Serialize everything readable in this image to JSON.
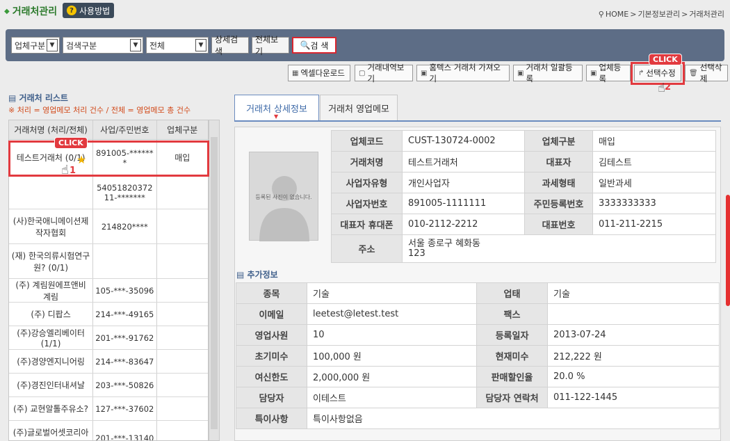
{
  "header": {
    "title": "거래처관리",
    "howto_label": "사용방법",
    "breadcrumb": [
      "HOME",
      "기본정보관리",
      "거래처관리"
    ]
  },
  "search": {
    "select1": "업체구분",
    "select2": "검색구분",
    "select3": "전체",
    "detail_search": "상세검색",
    "view_all": "전체보기",
    "search_button": "검 색"
  },
  "toolbar": {
    "excel": "엑셀다운로드",
    "history": "거래내역보기",
    "hometax": "홈텍스 거래처 가져오기",
    "bulk": "거래처 일괄등록",
    "register": "업체등록",
    "edit": "선택수정",
    "delete": "선택삭제"
  },
  "annotations": {
    "click": "CLICK",
    "step1": "1",
    "step2": "2"
  },
  "list": {
    "title": "거래처 리스트",
    "note": "※ 처리 = 영업메모 처리 건수 / 전체 = 영업메모 총 건수",
    "headers": [
      "거래처명 (처리/전체)",
      "사업/주민번호",
      "업체구분"
    ],
    "rows": [
      {
        "name": "테스트거래처 (0/1)",
        "id": "891005-*******",
        "type": "매입"
      },
      {
        "name": "",
        "id": "5405182037211-*******",
        "type": ""
      },
      {
        "name": "(사)한국애니메이션제작자협회",
        "id": "214820****",
        "type": ""
      },
      {
        "name": "(재) 한국의류시험연구원? (0/1)",
        "id": "",
        "type": ""
      },
      {
        "name": "(주) 계림원에프앤비 계림",
        "id": "105-***-35096",
        "type": ""
      },
      {
        "name": "(주) 디팝스",
        "id": "214-***-49165",
        "type": ""
      },
      {
        "name": "(주)강승엘리베이터 (1/1)",
        "id": "201-***-91762",
        "type": ""
      },
      {
        "name": "(주)경양엔지니어링",
        "id": "214-***-83647",
        "type": ""
      },
      {
        "name": "(주)경진인터내셔날",
        "id": "203-***-50826",
        "type": ""
      },
      {
        "name": "(주) 교현알톨주유소?",
        "id": "127-***-37602",
        "type": ""
      },
      {
        "name": "(주)글로벌어셋코리아보험",
        "id": "201-***-13140",
        "type": ""
      }
    ]
  },
  "tabs": {
    "detail": "거래처 상세정보",
    "memo": "거래처 영업메모"
  },
  "detail": {
    "photo_placeholder": "등록된 사진이 없습니다.",
    "code_label": "업체코드",
    "code": "CUST-130724-0002",
    "type_label": "업체구분",
    "type": "매입",
    "name_label": "거래처명",
    "name": "테스트거래처",
    "ceo_label": "대표자",
    "ceo": "김테스트",
    "biztype_label": "사업자유형",
    "biztype": "개인사업자",
    "tax_label": "과세형태",
    "tax": "일반과세",
    "bizno_label": "사업자번호",
    "bizno": "891005-1111111",
    "resno_label": "주민등록번호",
    "resno": "3333333333",
    "mobile_label": "대표자 휴대폰",
    "mobile": "010-2112-2212",
    "phone_label": "대표번호",
    "phone": "011-211-2215",
    "addr_label": "주소",
    "addr1": "서울 종로구 혜화동",
    "addr2": "123"
  },
  "extra": {
    "title": "추가정보",
    "item_label": "종목",
    "item": "기술",
    "biz_label": "업태",
    "biz": "기술",
    "email_label": "이메일",
    "email": "leetest@letest.test",
    "fax_label": "팩스",
    "fax": "",
    "sales_label": "영업사원",
    "sales": "10",
    "regdate_label": "등록일자",
    "regdate": "2013-07-24",
    "init_label": "초기미수",
    "init": "100,000 원",
    "cur_label": "현재미수",
    "cur": "212,222 원",
    "credit_label": "여신한도",
    "credit": "2,000,000 원",
    "discount_label": "판매할인율",
    "discount": "20.0 %",
    "manager_label": "담당자",
    "manager": "이테스트",
    "manager_phone_label": "담당자 연락처",
    "manager_phone": "011-122-1445",
    "note_label": "특이사항",
    "note": "특이사항없음"
  }
}
